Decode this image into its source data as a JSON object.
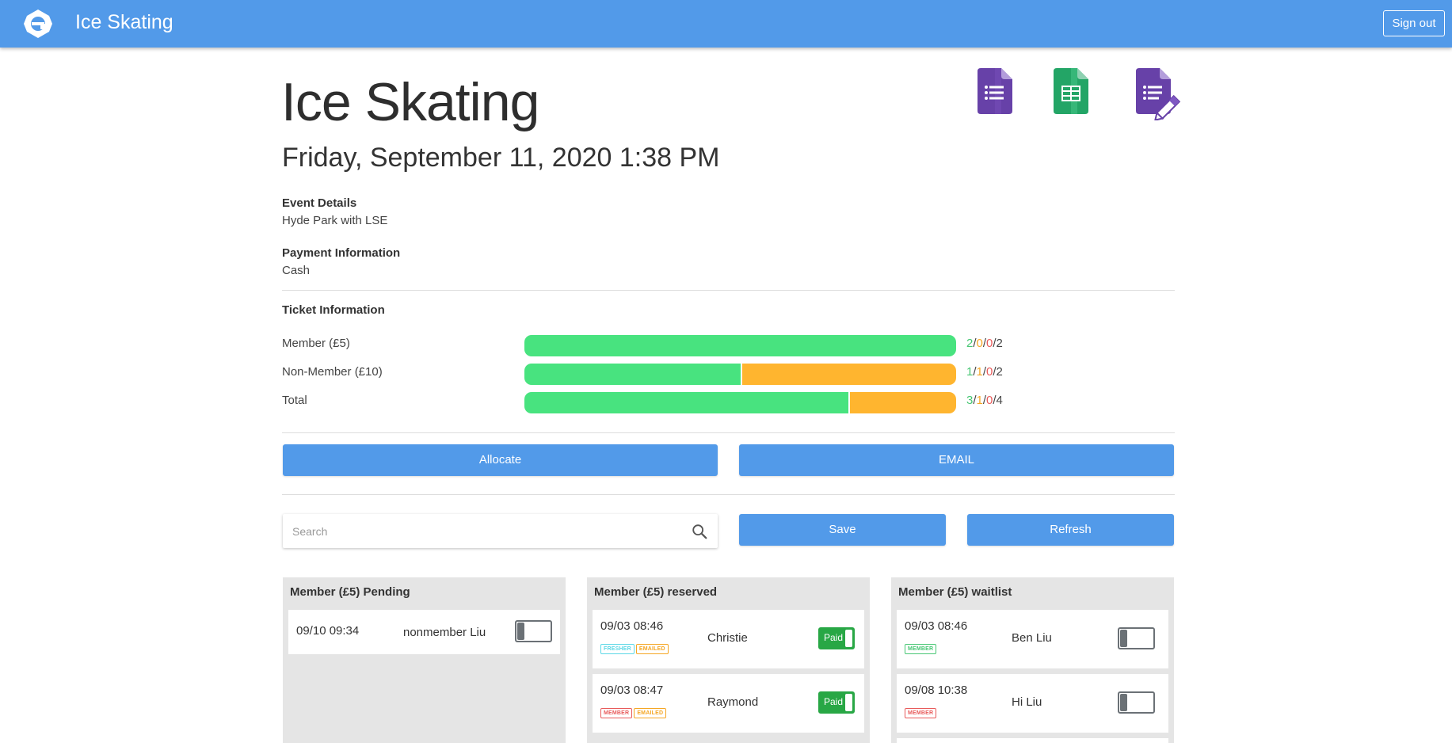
{
  "header": {
    "app_title": "Ice Skating",
    "signout_label": "Sign out"
  },
  "event": {
    "title": "Ice Skating",
    "date": "Friday, September 11, 2020 1:38 PM",
    "details_label": "Event Details",
    "details_value": "Hyde Park with LSE",
    "payment_label": "Payment Information",
    "payment_value": "Cash"
  },
  "icons": [
    "google-forms-icon",
    "google-sheets-icon",
    "google-forms-edit-icon"
  ],
  "tickets": {
    "heading": "Ticket Information",
    "rows": [
      {
        "label": "Member (£5)",
        "green_fraction": 1.0,
        "orange_fraction": 0.0,
        "c1": "2",
        "c2": "0",
        "c3": "0",
        "c4": "2"
      },
      {
        "label": "Non-Member (£10)",
        "green_fraction": 0.5,
        "orange_fraction": 0.5,
        "c1": "1",
        "c2": "1",
        "c3": "0",
        "c4": "2"
      },
      {
        "label": "Total",
        "green_fraction": 0.75,
        "orange_fraction": 0.25,
        "c1": "3",
        "c2": "1",
        "c3": "0",
        "c4": "4"
      }
    ]
  },
  "actions": {
    "allocate_label": "Allocate",
    "email_label": "EMAIL",
    "save_label": "Save",
    "refresh_label": "Refresh"
  },
  "search": {
    "placeholder": "Search",
    "value": ""
  },
  "colors": {
    "primary": "#529ae9",
    "green": "#48e37f",
    "orange": "#ffb52f",
    "paid": "#28a745"
  },
  "columns": [
    {
      "title": "Member (£5) Pending",
      "cards": [
        {
          "time": "09/10 09:34",
          "name": "nonmember Liu",
          "tags": [],
          "paid": false,
          "toggle_label": ""
        }
      ]
    },
    {
      "title": "Member (£5) reserved",
      "cards": [
        {
          "time": "09/03 08:46",
          "name": "Christie",
          "tags": [
            "FRESHER",
            "EMAILED"
          ],
          "paid": true,
          "toggle_label": "Paid"
        },
        {
          "time": "09/03 08:47",
          "name": "Raymond",
          "tags": [
            "MEMBER",
            "EMAILED"
          ],
          "paid": true,
          "toggle_label": "Paid"
        }
      ]
    },
    {
      "title": "Member (£5) waitlist",
      "cards": [
        {
          "time": "09/03 08:46",
          "name": "Ben Liu",
          "tags": [
            "MEMBER"
          ],
          "paid": false,
          "toggle_label": ""
        },
        {
          "time": "09/08 10:38",
          "name": "Hi Liu",
          "tags": [
            "MEMBER"
          ],
          "paid": false,
          "toggle_label": ""
        }
      ]
    }
  ]
}
